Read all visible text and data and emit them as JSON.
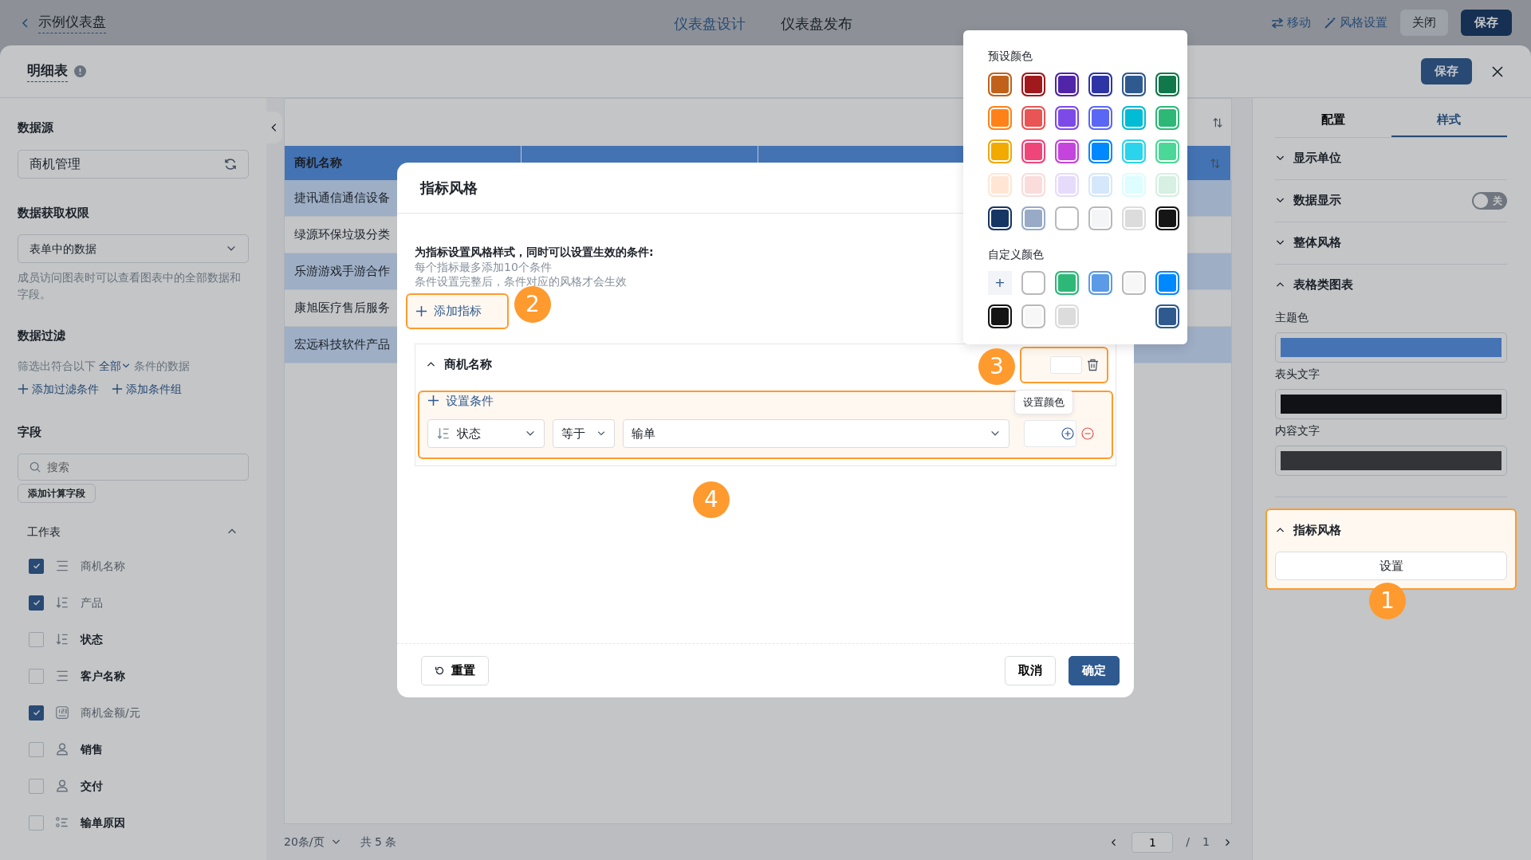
{
  "topbar": {
    "back_title": "示例仪表盘",
    "tabs": [
      {
        "label": "仪表盘设计",
        "selected": true
      },
      {
        "label": "仪表盘发布",
        "selected": false
      }
    ],
    "actions": [
      {
        "kind": "link",
        "label": "移动"
      },
      {
        "kind": "link",
        "label": "风格设置"
      },
      {
        "kind": "outline",
        "label": "关闭"
      },
      {
        "kind": "primary",
        "label": "保存"
      }
    ]
  },
  "panel": {
    "title": "明细表",
    "save": "保存"
  },
  "sidebar": {
    "data_source": {
      "heading": "数据源",
      "value": "商机管理"
    },
    "permission": {
      "heading": "数据获取权限",
      "value": "表单中的数据",
      "hint": "成员访问图表时可以查看图表中的全部数据和字段。"
    },
    "filter": {
      "heading": "数据过滤",
      "prefix": "筛选出符合以下",
      "scope": "全部",
      "suffix": "条件的数据",
      "actions": [
        "添加过滤条件",
        "添加条件组"
      ]
    },
    "fields": {
      "heading": "字段",
      "search_placeholder": "搜索",
      "add_button": "添加计算字段",
      "group": {
        "label": "工作表",
        "expanded": true,
        "items": [
          {
            "label": "商机名称",
            "kind": "text",
            "checked": true
          },
          {
            "label": "产品",
            "kind": "select",
            "checked": true
          },
          {
            "label": "状态",
            "kind": "select",
            "checked": false
          },
          {
            "label": "客户名称",
            "kind": "text",
            "checked": false
          },
          {
            "label": "商机金额/元",
            "kind": "number",
            "checked": true
          },
          {
            "label": "销售",
            "kind": "member",
            "checked": false
          },
          {
            "label": "交付",
            "kind": "member",
            "checked": false
          },
          {
            "label": "输单原因",
            "kind": "multi",
            "checked": false
          }
        ]
      }
    }
  },
  "table": {
    "columns": [
      {
        "label": "商机名称"
      }
    ],
    "rows": [
      "捷讯通信通信设备",
      "绿源环保垃圾分类",
      "乐游游戏手游合作",
      "康旭医疗售后服务",
      "宏远科技软件产品"
    ]
  },
  "pagination": {
    "page_size": "20条/页",
    "total": "共 5 条",
    "page": "1",
    "separator": "/",
    "pages": "1"
  },
  "modal": {
    "title": "指标风格",
    "intro": "为指标设置风格样式，同时可以设置生效的条件:",
    "notes": [
      "每个指标最多添加10个条件",
      "条件设置完整后，条件对应的风格才会生效"
    ],
    "add_button": {
      "label": "添加指标",
      "highlighted": true
    },
    "metric": {
      "name": "商机名称",
      "expanded": true,
      "color_field_highlighted": true,
      "add_condition": "设置条件",
      "tooltip": "设置颜色",
      "condition": {
        "highlighted": true,
        "field": "状态",
        "operator": "等于",
        "value": "输单"
      }
    },
    "footer": {
      "reset": "重置",
      "cancel": "取消",
      "confirm": "确定"
    }
  },
  "color_picker": {
    "preset_title": "预设颜色",
    "presets": [
      {
        "color": "#c0621a"
      },
      {
        "color": "#a0191d"
      },
      {
        "color": "#5025a8"
      },
      {
        "color": "#2e35a4"
      },
      {
        "color": "#2f5a8f"
      },
      {
        "color": "#10784a"
      },
      {
        "color": "#ff8219"
      },
      {
        "color": "#e95454"
      },
      {
        "color": "#7d4ae8"
      },
      {
        "color": "#5a66f4"
      },
      {
        "color": "#00bcd4"
      },
      {
        "color": "#2db877"
      },
      {
        "color": "#f2a900"
      },
      {
        "color": "#f0457b"
      },
      {
        "color": "#c544de"
      },
      {
        "color": "#0088ff"
      },
      {
        "color": "#2ad4ec"
      },
      {
        "color": "#4bd797"
      },
      {
        "color": "#ffe6d4"
      },
      {
        "color": "#fadcdc"
      },
      {
        "color": "#e6dbfb"
      },
      {
        "color": "#d5e7fb"
      },
      {
        "color": "#ddfdfe"
      },
      {
        "color": "#d6f0e3"
      },
      {
        "color": "#163663"
      },
      {
        "color": "#98aac6"
      },
      {
        "color": "#ffffff"
      },
      {
        "color": "#f4f5f7"
      },
      {
        "color": "#dcdcdc"
      },
      {
        "color": "#151515"
      }
    ],
    "custom_title": "自定义颜色",
    "custom": [
      {
        "kind": "add",
        "label": "+"
      },
      {
        "kind": "swatch",
        "color": "#ffffff"
      },
      {
        "kind": "swatch",
        "color": "#2db877"
      },
      {
        "kind": "swatch",
        "color": "#5a9ae6"
      },
      {
        "kind": "swatch",
        "color": "#f7f7f7"
      },
      {
        "kind": "swatch",
        "color": "#0088ff"
      },
      {
        "kind": "swatch",
        "color": "#151515"
      },
      {
        "kind": "swatch",
        "color": "#f7f7f7"
      },
      {
        "kind": "swatch",
        "color": "#dcdcdc"
      },
      {
        "kind": "blank"
      },
      {
        "kind": "blank"
      },
      {
        "kind": "swatch",
        "color": "#2f5a8f"
      }
    ]
  },
  "style_panel": {
    "tabs": [
      {
        "label": "配置",
        "selected": false
      },
      {
        "label": "样式",
        "selected": true
      }
    ],
    "sections": [
      {
        "title": "显示单位",
        "expanded": false
      },
      {
        "title": "数据显示",
        "expanded": false,
        "toggle": {
          "on": false,
          "label": "关"
        }
      },
      {
        "title": "整体风格",
        "expanded": false
      },
      {
        "title": "表格类图表",
        "expanded": true,
        "fields": [
          {
            "label": "主题色",
            "color": "#4573b4"
          },
          {
            "label": "表头文字",
            "color": "#111216"
          },
          {
            "label": "内容文字",
            "color": "#333438"
          }
        ]
      },
      {
        "title": "指标风格",
        "expanded": true,
        "highlighted": true,
        "button": "设置"
      }
    ]
  },
  "annotations": [
    {
      "number": "1"
    },
    {
      "number": "2"
    },
    {
      "number": "3"
    },
    {
      "number": "4"
    }
  ]
}
